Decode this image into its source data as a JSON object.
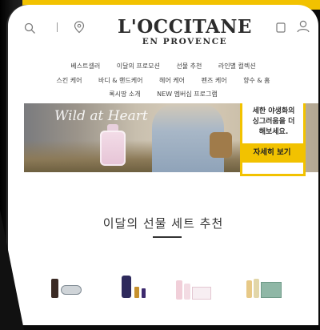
{
  "brand": {
    "name": "L'OCCITANE",
    "tagline": "EN PROVENCE"
  },
  "header": {
    "search_icon": "search-icon",
    "location_icon": "location-pin-icon",
    "bag_icon": "bag-icon",
    "account_icon": "user-icon"
  },
  "nav": {
    "row1": [
      "베스트셀러",
      "이달의 프로모션",
      "선물 추천",
      "라인별 컬렉션"
    ],
    "row2": [
      "스킨 케어",
      "바디 & 핸드케어",
      "헤어 케어",
      "펜즈 케어",
      "향수 & 홈"
    ],
    "row3": [
      "록시땅 소개",
      "NEW 멤버십 프로그램"
    ]
  },
  "banner": {
    "script_text": "Wild at Heart",
    "promo_text_lines": [
      "세한 야생화의",
      "싱그러움을 더",
      "해보세요."
    ],
    "cta_label": "자세히 보기"
  },
  "section": {
    "title": "이달의 선물 세트 추천"
  },
  "colors": {
    "accent": "#f2c200",
    "text": "#333333"
  }
}
